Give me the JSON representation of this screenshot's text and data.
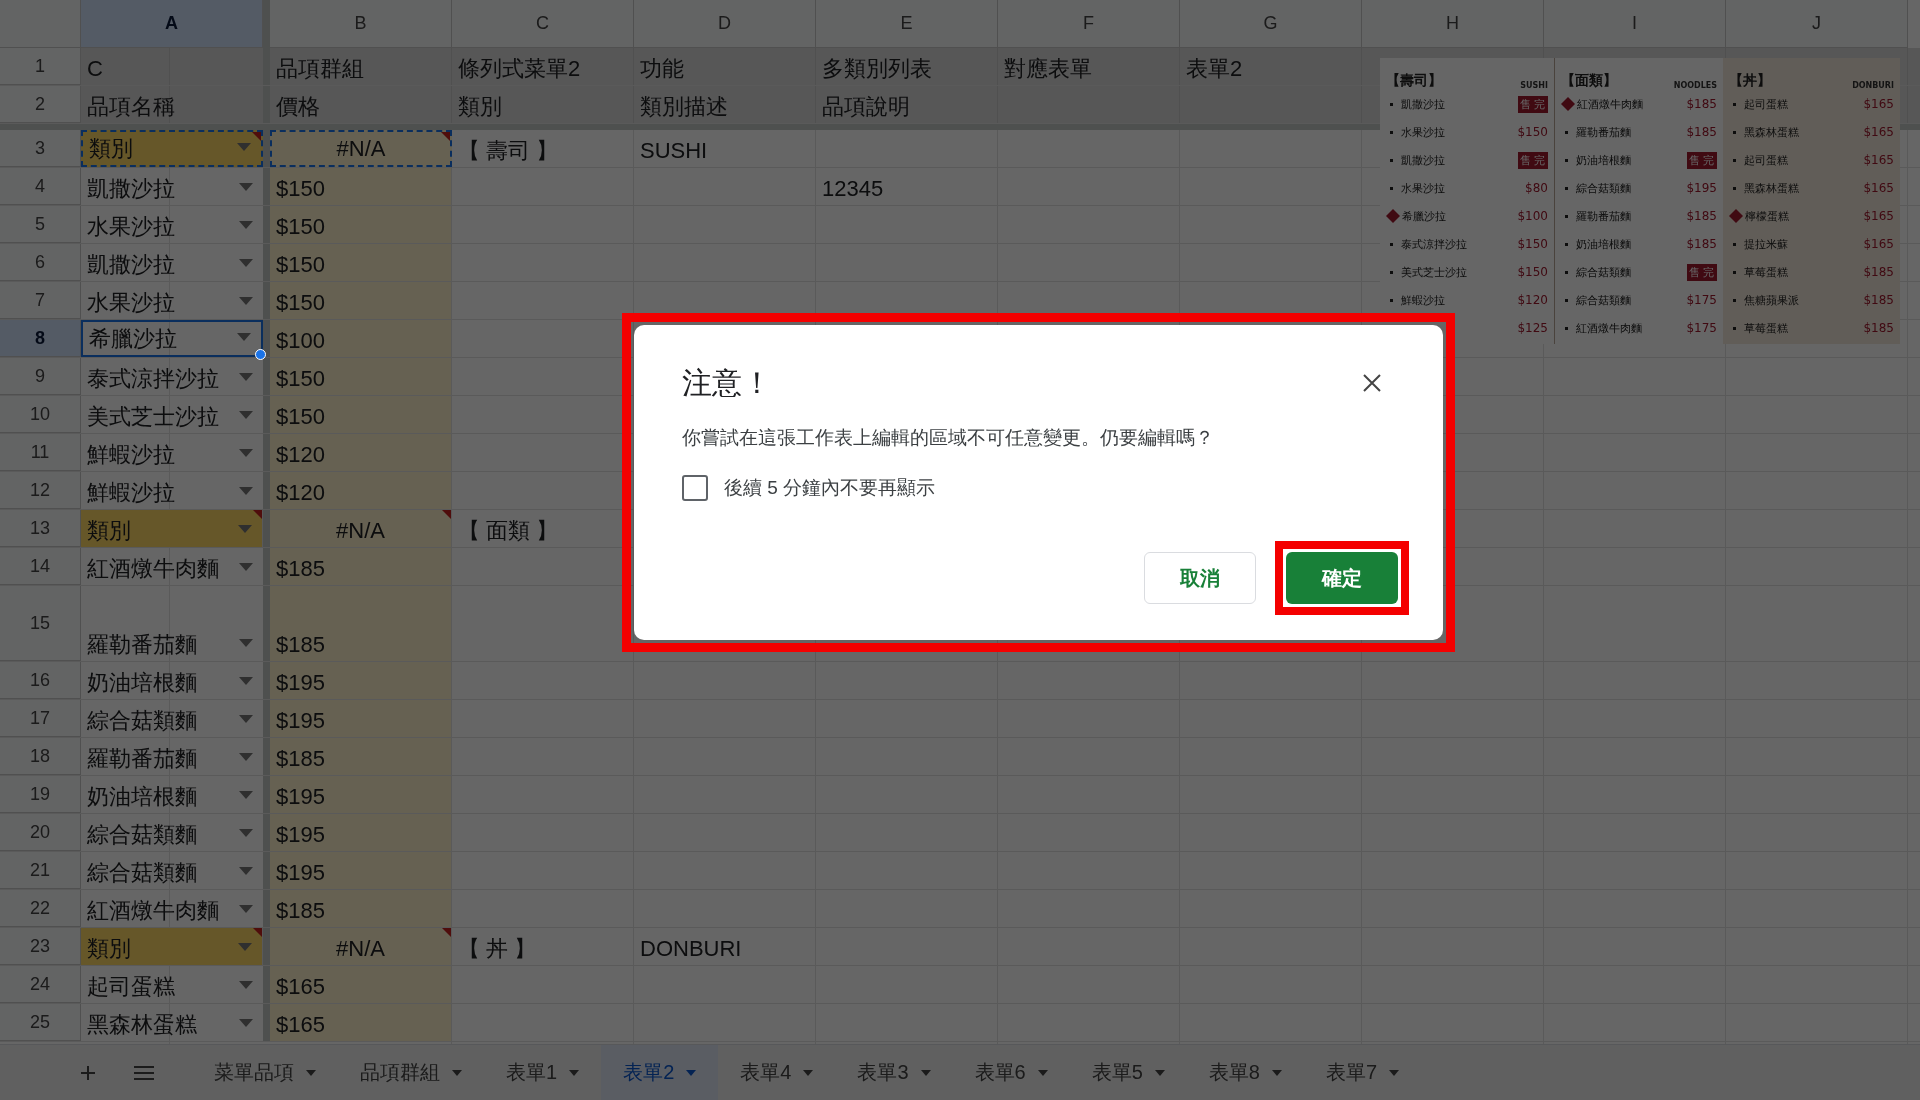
{
  "columns": [
    {
      "label": "A",
      "selected": true
    },
    {
      "label": "B",
      "selected": false
    },
    {
      "label": "C",
      "selected": false
    },
    {
      "label": "D",
      "selected": false
    },
    {
      "label": "E",
      "selected": false
    },
    {
      "label": "F",
      "selected": false
    },
    {
      "label": "G",
      "selected": false
    },
    {
      "label": "H",
      "selected": false
    },
    {
      "label": "I",
      "selected": false
    },
    {
      "label": "J",
      "selected": false
    }
  ],
  "rows": [
    {
      "number": "1",
      "kind": "header",
      "selected": false,
      "marquee": false,
      "tall": false,
      "cells": {
        "a": "C",
        "b": "品項群組",
        "c": "條列式菜單2",
        "d": "功能",
        "e": "多類別列表",
        "f": "對應表單",
        "g": "表單2"
      }
    },
    {
      "number": "2",
      "kind": "header",
      "selected": false,
      "marquee": false,
      "tall": false,
      "cells": {
        "a": "品項名稱",
        "b": "價格",
        "c": "類別",
        "d": "類別描述",
        "e": "品項說明"
      }
    },
    {
      "number": "3",
      "kind": "category",
      "selected": false,
      "marquee": true,
      "tall": false,
      "cells": {
        "a": "類別",
        "b": "#N/A",
        "c": "【 壽司 】",
        "d": "SUSHI"
      }
    },
    {
      "number": "4",
      "kind": "item",
      "selected": false,
      "marquee": false,
      "tall": false,
      "cells": {
        "a": "凱撒沙拉",
        "b": "$150",
        "e": "12345"
      }
    },
    {
      "number": "5",
      "kind": "item",
      "selected": false,
      "marquee": false,
      "tall": false,
      "cells": {
        "a": "水果沙拉",
        "b": "$150"
      }
    },
    {
      "number": "6",
      "kind": "item",
      "selected": false,
      "marquee": false,
      "tall": false,
      "cells": {
        "a": "凱撒沙拉",
        "b": "$150"
      }
    },
    {
      "number": "7",
      "kind": "item",
      "selected": false,
      "marquee": false,
      "tall": false,
      "cells": {
        "a": "水果沙拉",
        "b": "$150"
      }
    },
    {
      "number": "8",
      "kind": "item",
      "selected": true,
      "marquee": false,
      "tall": false,
      "cells": {
        "a": "希臘沙拉",
        "b": "$100"
      }
    },
    {
      "number": "9",
      "kind": "item",
      "selected": false,
      "marquee": false,
      "tall": false,
      "cells": {
        "a": "泰式涼拌沙拉",
        "b": "$150"
      }
    },
    {
      "number": "10",
      "kind": "item",
      "selected": false,
      "marquee": false,
      "tall": false,
      "cells": {
        "a": "美式芝士沙拉",
        "b": "$150"
      }
    },
    {
      "number": "11",
      "kind": "item",
      "selected": false,
      "marquee": false,
      "tall": false,
      "cells": {
        "a": "鮮蝦沙拉",
        "b": "$120"
      }
    },
    {
      "number": "12",
      "kind": "item",
      "selected": false,
      "marquee": false,
      "tall": false,
      "cells": {
        "a": "鮮蝦沙拉",
        "b": "$120"
      }
    },
    {
      "number": "13",
      "kind": "category",
      "selected": false,
      "marquee": false,
      "tall": false,
      "cells": {
        "a": "類別",
        "b": "#N/A",
        "c": "【 面類 】"
      }
    },
    {
      "number": "14",
      "kind": "item",
      "selected": false,
      "marquee": false,
      "tall": false,
      "cells": {
        "a": "紅酒燉牛肉麵",
        "b": "$185"
      }
    },
    {
      "number": "15",
      "kind": "item",
      "selected": false,
      "marquee": false,
      "tall": true,
      "cells": {
        "a": "羅勒番茄麵",
        "b": "$185"
      }
    },
    {
      "number": "16",
      "kind": "item",
      "selected": false,
      "marquee": false,
      "tall": false,
      "cells": {
        "a": "奶油培根麵",
        "b": "$195"
      }
    },
    {
      "number": "17",
      "kind": "item",
      "selected": false,
      "marquee": false,
      "tall": false,
      "cells": {
        "a": "綜合菇類麵",
        "b": "$195"
      }
    },
    {
      "number": "18",
      "kind": "item",
      "selected": false,
      "marquee": false,
      "tall": false,
      "cells": {
        "a": "羅勒番茄麵",
        "b": "$185"
      }
    },
    {
      "number": "19",
      "kind": "item",
      "selected": false,
      "marquee": false,
      "tall": false,
      "cells": {
        "a": "奶油培根麵",
        "b": "$195"
      }
    },
    {
      "number": "20",
      "kind": "item",
      "selected": false,
      "marquee": false,
      "tall": false,
      "cells": {
        "a": "綜合菇類麵",
        "b": "$195"
      }
    },
    {
      "number": "21",
      "kind": "item",
      "selected": false,
      "marquee": false,
      "tall": false,
      "cells": {
        "a": "綜合菇類麵",
        "b": "$195"
      }
    },
    {
      "number": "22",
      "kind": "item",
      "selected": false,
      "marquee": false,
      "tall": false,
      "cells": {
        "a": "紅酒燉牛肉麵",
        "b": "$185"
      }
    },
    {
      "number": "23",
      "kind": "category",
      "selected": false,
      "marquee": false,
      "tall": false,
      "cells": {
        "a": "類別",
        "b": "#N/A",
        "c": "【 丼 】",
        "d": "DONBURI"
      }
    },
    {
      "number": "24",
      "kind": "item",
      "selected": false,
      "marquee": false,
      "tall": false,
      "cells": {
        "a": "起司蛋糕",
        "b": "$165"
      }
    },
    {
      "number": "25",
      "kind": "item",
      "selected": false,
      "marquee": false,
      "tall": false,
      "cells": {
        "a": "黑森林蛋糕",
        "b": "$165"
      }
    }
  ],
  "menu_image": {
    "sections": [
      {
        "title": "【壽司】",
        "tag": "SUSHI",
        "highlighted": false,
        "items": [
          {
            "kind": "dot",
            "name": "凱撒沙拉",
            "badge": "售完"
          },
          {
            "kind": "dot",
            "name": "水果沙拉",
            "price": "$150"
          },
          {
            "kind": "dot",
            "name": "凱撒沙拉",
            "badge": "售完"
          },
          {
            "kind": "dot",
            "name": "水果沙拉",
            "price": "$80"
          },
          {
            "kind": "hot",
            "name": "希臘沙拉",
            "price": "$100"
          },
          {
            "kind": "dot",
            "name": "泰式涼拌沙拉",
            "price": "$150"
          },
          {
            "kind": "dot",
            "name": "美式芝士沙拉",
            "price": "$150"
          },
          {
            "kind": "dot",
            "name": "鮮蝦沙拉",
            "price": "$120"
          },
          {
            "kind": "hidden",
            "price": "$125"
          }
        ]
      },
      {
        "title": "【面類】",
        "tag": "NOODLES",
        "highlighted": false,
        "items": [
          {
            "kind": "hot",
            "name": "紅酒燉牛肉麵",
            "price": "$185"
          },
          {
            "kind": "dot",
            "name": "羅勒番茄麵",
            "price": "$185"
          },
          {
            "kind": "dot",
            "name": "奶油培根麵",
            "badge": "售完"
          },
          {
            "kind": "dot",
            "name": "綜合菇類麵",
            "price": "$195"
          },
          {
            "kind": "dot",
            "name": "羅勒番茄麵",
            "price": "$185"
          },
          {
            "kind": "dot",
            "name": "奶油培根麵",
            "price": "$185"
          },
          {
            "kind": "dot",
            "name": "綜合菇類麵",
            "badge": "售完"
          },
          {
            "kind": "dot",
            "name": "綜合菇類麵",
            "price": "$175"
          },
          {
            "kind": "dot",
            "name": "紅酒燉牛肉麵",
            "price": "$175"
          }
        ]
      },
      {
        "title": "【丼】",
        "tag": "DONBURI",
        "highlighted": true,
        "items": [
          {
            "kind": "dot",
            "name": "起司蛋糕",
            "price": "$165"
          },
          {
            "kind": "dot",
            "name": "黑森林蛋糕",
            "price": "$165"
          },
          {
            "kind": "dot",
            "name": "起司蛋糕",
            "price": "$165"
          },
          {
            "kind": "dot",
            "name": "黑森林蛋糕",
            "price": "$165"
          },
          {
            "kind": "hot",
            "name": "檸檬蛋糕",
            "price": "$165"
          },
          {
            "kind": "dot",
            "name": "提拉米蘇",
            "price": "$165"
          },
          {
            "kind": "dot",
            "name": "草莓蛋糕",
            "price": "$185"
          },
          {
            "kind": "dot",
            "name": "焦糖蘋果派",
            "price": "$185"
          },
          {
            "kind": "dot",
            "name": "草莓蛋糕",
            "price": "$185"
          }
        ]
      }
    ]
  },
  "sheet_tabs": [
    {
      "label": "菜單品項",
      "selected": false
    },
    {
      "label": "品項群組",
      "selected": false
    },
    {
      "label": "表單1",
      "selected": false
    },
    {
      "label": "表單2",
      "selected": true
    },
    {
      "label": "表單4",
      "selected": false
    },
    {
      "label": "表單3",
      "selected": false
    },
    {
      "label": "表單6",
      "selected": false
    },
    {
      "label": "表單5",
      "selected": false
    },
    {
      "label": "表單8",
      "selected": false
    },
    {
      "label": "表單7",
      "selected": false
    }
  ],
  "dialog": {
    "title": "注意！",
    "message": "你嘗試在這張工作表上編輯的區域不可任意變更。仍要編輯嗎？",
    "highlighted": true,
    "checkbox": {
      "label": "後續 5 分鐘內不要再顯示",
      "checked": false
    },
    "buttons": [
      {
        "label": "取消",
        "kind": "secondary",
        "highlighted": false
      },
      {
        "label": "確定",
        "kind": "primary",
        "highlighted": true
      }
    ]
  }
}
